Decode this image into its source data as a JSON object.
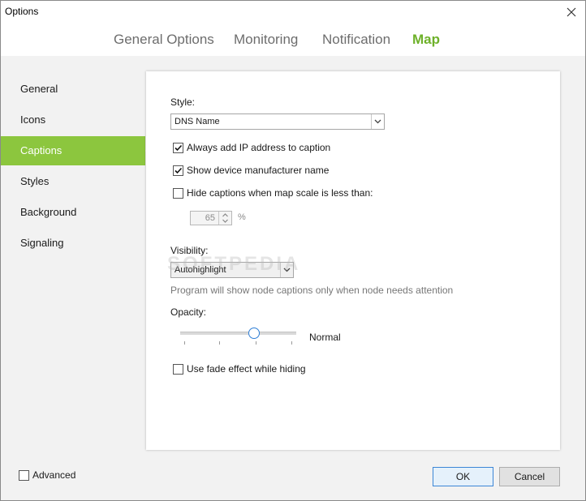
{
  "window": {
    "title": "Options"
  },
  "tabs": [
    {
      "label": "General Options"
    },
    {
      "label": "Monitoring"
    },
    {
      "label": "Notification"
    },
    {
      "label": "Map",
      "active": true
    }
  ],
  "sidebar": {
    "items": [
      {
        "label": "General"
      },
      {
        "label": "Icons"
      },
      {
        "label": "Captions",
        "active": true
      },
      {
        "label": "Styles"
      },
      {
        "label": "Background"
      },
      {
        "label": "Signaling"
      }
    ]
  },
  "captions": {
    "style_label": "Style:",
    "style_value": "DNS Name",
    "always_add_ip_label": "Always add IP address to caption",
    "always_add_ip_checked": true,
    "show_manufacturer_label": "Show device manufacturer name",
    "show_manufacturer_checked": true,
    "hide_captions_label": "Hide captions when map scale is less than:",
    "hide_captions_checked": false,
    "scale_value": "65",
    "scale_unit": "%",
    "visibility_label": "Visibility:",
    "visibility_value": "Autohighlight",
    "visibility_hint": "Program will show node captions only when node needs attention",
    "opacity_label": "Opacity:",
    "opacity_value_label": "Normal",
    "opacity_level": 0.65,
    "fade_label": "Use fade effect while hiding",
    "fade_checked": false
  },
  "footer": {
    "advanced_label": "Advanced",
    "advanced_checked": false,
    "ok_label": "OK",
    "cancel_label": "Cancel"
  },
  "watermark": "SOFTPEDIA",
  "colors": {
    "accent": "#8cc63e",
    "active_tab": "#6eb12a",
    "focus_border": "#3c86d6"
  },
  "icons": {
    "close": "close-icon",
    "dropdown": "chevron-down-icon",
    "check": "checkmark-icon",
    "spin_up": "chevron-up-icon",
    "spin_down": "chevron-down-icon"
  }
}
